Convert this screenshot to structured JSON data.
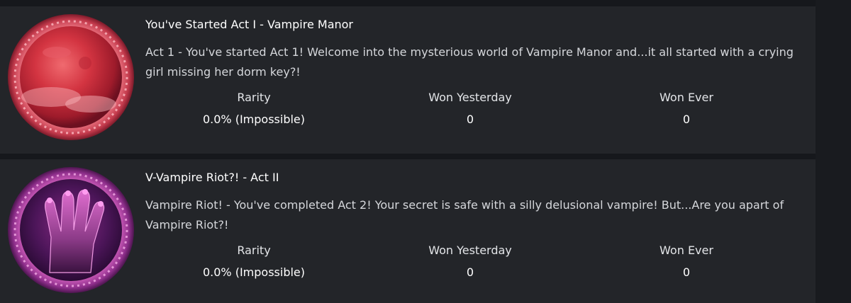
{
  "achievements": [
    {
      "title": "You've Started Act I - Vampire Manor",
      "description": "Act 1 - You've started Act 1! Welcome into the mysterious world of Vampire Manor and...it all started with a crying girl missing her dorm key?!",
      "badge_icon": "red-moon-badge-icon",
      "stats": {
        "rarity_label": "Rarity",
        "rarity_value": "0.0% (Impossible)",
        "won_yesterday_label": "Won Yesterday",
        "won_yesterday_value": "0",
        "won_ever_label": "Won Ever",
        "won_ever_value": "0"
      }
    },
    {
      "title": "V-Vampire Riot?! - Act II",
      "description": "Vampire Riot! - You've completed Act 2! Your secret is safe with a silly delusional vampire! But...Are you apart of Vampire Riot?!",
      "badge_icon": "clawed-hand-badge-icon",
      "stats": {
        "rarity_label": "Rarity",
        "rarity_value": "0.0% (Impossible)",
        "won_yesterday_label": "Won Yesterday",
        "won_yesterday_value": "0",
        "won_ever_label": "Won Ever",
        "won_ever_value": "0"
      }
    }
  ],
  "colors": {
    "page_background": "#16181c",
    "card_background": "#232529",
    "title_text": "#ffffff",
    "body_text": "#d5d7db",
    "badge1_primary": "#c8283c",
    "badge2_primary": "#b0308a"
  }
}
